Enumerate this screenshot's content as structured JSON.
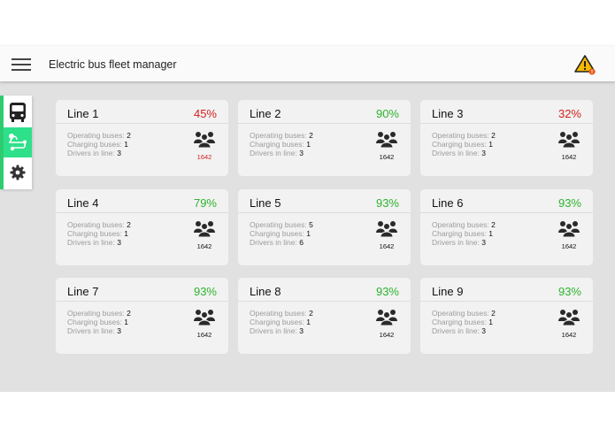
{
  "header": {
    "title": "Electric bus fleet manager"
  },
  "icons": {
    "menu": "menu-icon",
    "warning": "warning-icon",
    "bus": "bus-icon",
    "route": "route-icon",
    "settings": "gear-icon",
    "people": "people-icon"
  },
  "colors": {
    "accent": "#2ee08a",
    "good": "#2db32d",
    "bad": "#d42020",
    "warning": "#f5b800"
  },
  "lines": [
    {
      "name": "Line 1",
      "percent": "45%",
      "status": "low",
      "operating_label": "Operating buses:",
      "operating": "2",
      "charging_label": "Charging buses:",
      "charging": "1",
      "drivers_label": "Drivers in line:",
      "drivers": "3",
      "passengers": "1642"
    },
    {
      "name": "Line 2",
      "percent": "90%",
      "status": "high",
      "operating_label": "Operating buses:",
      "operating": "2",
      "charging_label": "Charging buses:",
      "charging": "1",
      "drivers_label": "Drivers in line:",
      "drivers": "3",
      "passengers": "1642"
    },
    {
      "name": "Line 3",
      "percent": "32%",
      "status": "low",
      "operating_label": "Operating buses:",
      "operating": "2",
      "charging_label": "Charging buses:",
      "charging": "1",
      "drivers_label": "Drivers in line:",
      "drivers": "3",
      "passengers": "1642"
    },
    {
      "name": "Line 4",
      "percent": "79%",
      "status": "high",
      "operating_label": "Operating buses:",
      "operating": "2",
      "charging_label": "Charging buses:",
      "charging": "1",
      "drivers_label": "Drivers in line:",
      "drivers": "3",
      "passengers": "1642"
    },
    {
      "name": "Line 5",
      "percent": "93%",
      "status": "high",
      "operating_label": "Operating buses:",
      "operating": "5",
      "charging_label": "Charging buses:",
      "charging": "1",
      "drivers_label": "Drivers in line:",
      "drivers": "6",
      "passengers": "1642"
    },
    {
      "name": "Line 6",
      "percent": "93%",
      "status": "high",
      "operating_label": "Operating buses:",
      "operating": "2",
      "charging_label": "Charging buses:",
      "charging": "1",
      "drivers_label": "Drivers in line:",
      "drivers": "3",
      "passengers": "1642"
    },
    {
      "name": "Line 7",
      "percent": "93%",
      "status": "high",
      "operating_label": "Operating buses:",
      "operating": "2",
      "charging_label": "Charging buses:",
      "charging": "1",
      "drivers_label": "Drivers in line:",
      "drivers": "3",
      "passengers": "1642"
    },
    {
      "name": "Line 8",
      "percent": "93%",
      "status": "high",
      "operating_label": "Operating buses:",
      "operating": "2",
      "charging_label": "Charging buses:",
      "charging": "1",
      "drivers_label": "Drivers in line:",
      "drivers": "3",
      "passengers": "1642"
    },
    {
      "name": "Line 9",
      "percent": "93%",
      "status": "high",
      "operating_label": "Operating buses:",
      "operating": "2",
      "charging_label": "Charging buses:",
      "charging": "1",
      "drivers_label": "Drivers in line:",
      "drivers": "3",
      "passengers": "1642"
    }
  ]
}
